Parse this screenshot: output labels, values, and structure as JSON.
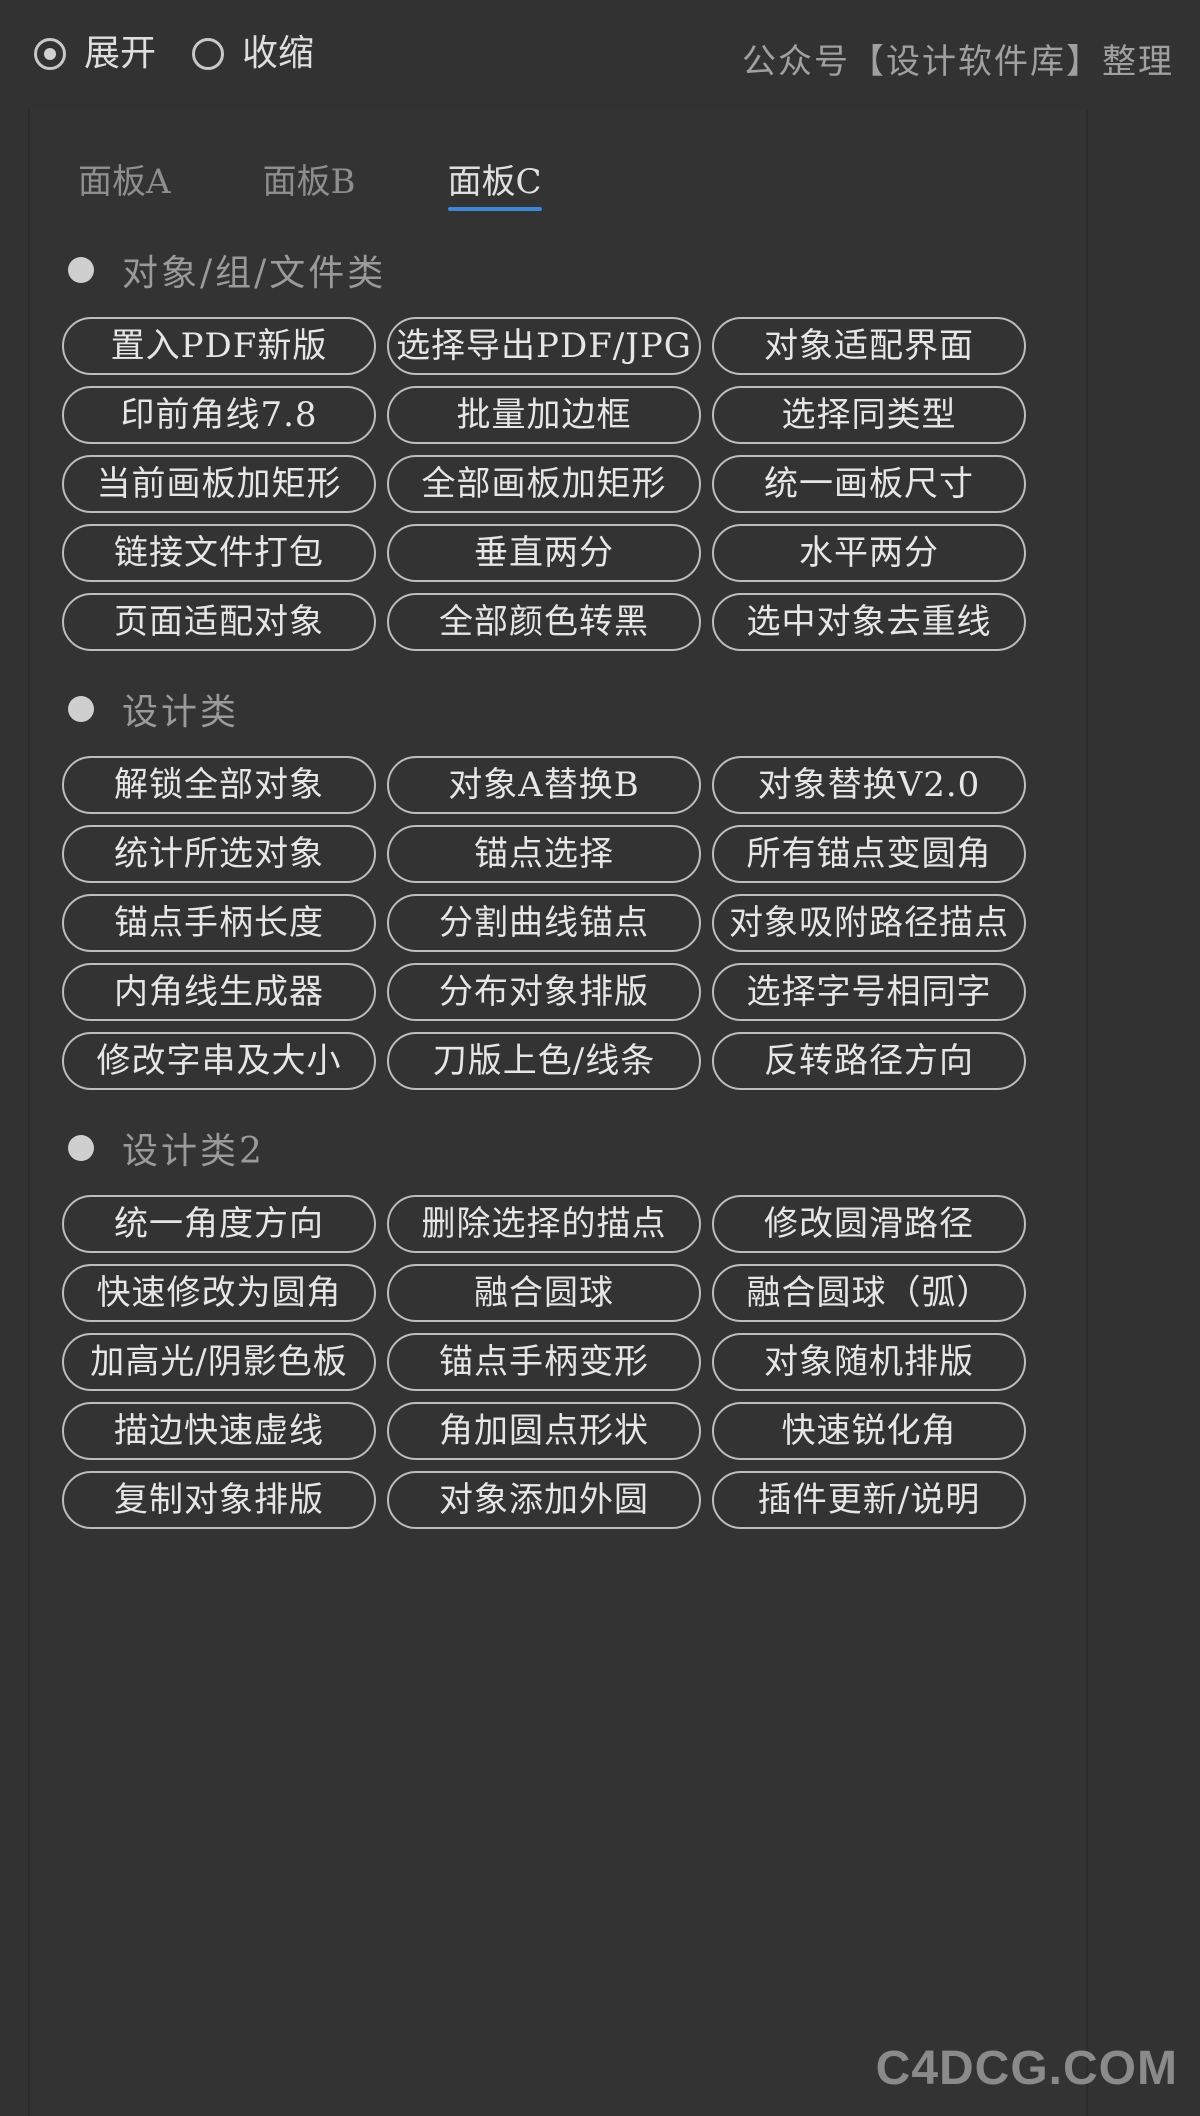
{
  "top": {
    "mode_options": [
      {
        "label": "展开",
        "checked": true
      },
      {
        "label": "收缩",
        "checked": false
      }
    ],
    "credit": "公众号【设计软件库】整理"
  },
  "tabs": [
    {
      "label": "面板A",
      "active": false
    },
    {
      "label": "面板B",
      "active": false
    },
    {
      "label": "面板C",
      "active": true
    }
  ],
  "sections": [
    {
      "title": "对象/组/文件类",
      "buttons": [
        "置入PDF新版",
        "选择导出PDF/JPG",
        "对象适配界面",
        "印前角线7.8",
        "批量加边框",
        "选择同类型",
        "当前画板加矩形",
        "全部画板加矩形",
        "统一画板尺寸",
        "链接文件打包",
        "垂直两分",
        "水平两分",
        "页面适配对象",
        "全部颜色转黑",
        "选中对象去重线"
      ]
    },
    {
      "title": "设计类",
      "buttons": [
        "解锁全部对象",
        "对象A替换B",
        "对象替换V2.0",
        "统计所选对象",
        "锚点选择",
        "所有锚点变圆角",
        "锚点手柄长度",
        "分割曲线锚点",
        "对象吸附路径描点",
        "内角线生成器",
        "分布对象排版",
        "选择字号相同字",
        "修改字串及大小",
        "刀版上色/线条",
        "反转路径方向"
      ]
    },
    {
      "title": "设计类2",
      "buttons": [
        "统一角度方向",
        "删除选择的描点",
        "修改圆滑路径",
        "快速修改为圆角",
        "融合圆球",
        "融合圆球（弧）",
        "加高光/阴影色板",
        "锚点手柄变形",
        "对象随机排版",
        "描边快速虚线",
        "角加圆点形状",
        "快速锐化角",
        "复制对象排版",
        "对象添加外圆",
        "插件更新/说明"
      ]
    }
  ],
  "watermark": "C4DCG.COM"
}
